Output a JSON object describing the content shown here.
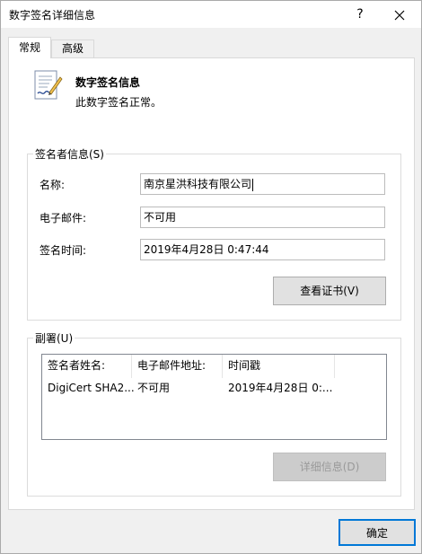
{
  "window": {
    "title": "数字签名详细信息",
    "help_glyph": "?",
    "close_glyph": "✕"
  },
  "tabs": [
    {
      "label": "常规",
      "selected": true
    },
    {
      "label": "高级",
      "selected": false
    }
  ],
  "signature": {
    "icon": "signed-document-icon",
    "title": "数字签名信息",
    "status": "此数字签名正常。"
  },
  "signer": {
    "legend": "签名者信息(S)",
    "fields": [
      {
        "label": "名称:",
        "value": "南京星洪科技有限公司"
      },
      {
        "label": "电子邮件:",
        "value": "不可用"
      },
      {
        "label": "签名时间:",
        "value": "2019年4月28日 0:47:44"
      }
    ],
    "view_cert_label": "查看证书(V)"
  },
  "countersignatures": {
    "legend": "副署(U)",
    "columns": [
      "签名者姓名:",
      "电子邮件地址:",
      "时间戳"
    ],
    "rows": [
      [
        "DigiCert SHA2...",
        "不可用",
        "2019年4月28日 0:..."
      ]
    ],
    "details_label": "详细信息(D)"
  },
  "footer": {
    "ok_label": "确定"
  },
  "colors": {
    "accent": "#0078d7",
    "dialog_bg": "#f0f0f0"
  }
}
